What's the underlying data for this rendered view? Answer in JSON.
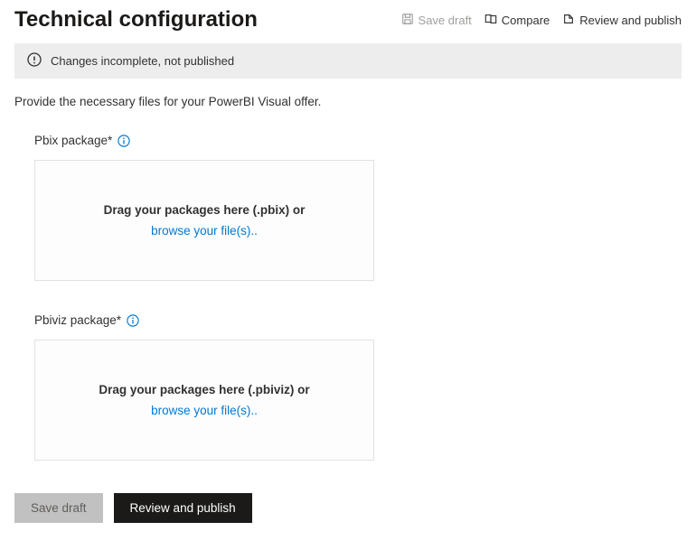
{
  "header": {
    "title": "Technical configuration",
    "toolbar": {
      "save_draft": "Save draft",
      "compare": "Compare",
      "review_publish": "Review and publish"
    }
  },
  "status_banner": {
    "message": "Changes incomplete, not published"
  },
  "description": "Provide the necessary files for your PowerBI Visual offer.",
  "pbix": {
    "label": "Pbix package*",
    "drag_text": "Drag your packages here (.pbix) or",
    "browse_text": "browse your file(s).."
  },
  "pbiviz": {
    "label": "Pbiviz package*",
    "drag_text": "Drag your packages here (.pbiviz) or",
    "browse_text": "browse your file(s).."
  },
  "buttons": {
    "save_draft": "Save draft",
    "review_publish": "Review and publish"
  }
}
